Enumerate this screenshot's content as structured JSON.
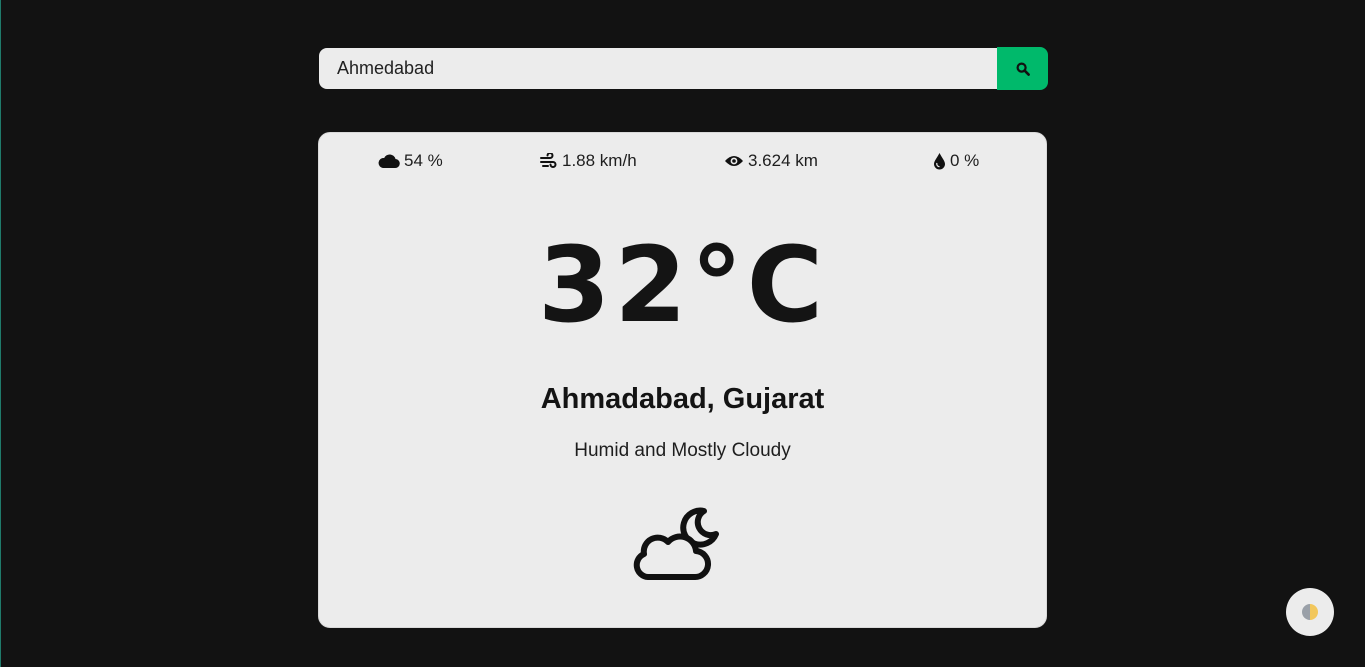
{
  "search": {
    "value": "Ahmedabad",
    "button_icon": "search-icon"
  },
  "stats": {
    "cloudiness": {
      "icon": "cloud-icon",
      "text": "54 %"
    },
    "wind": {
      "icon": "wind-icon",
      "text": "1.88 km/h"
    },
    "visibility": {
      "icon": "eye-icon",
      "text": "3.624 km"
    },
    "precipitation": {
      "icon": "droplet-icon",
      "text": "0 %"
    }
  },
  "weather": {
    "temperature": "32°C",
    "location": "Ahmadabad, Gujarat",
    "condition": "Humid and Mostly Cloudy",
    "icon": "cloud-moon-icon"
  },
  "theme_toggle": {
    "icon": "contrast-icon"
  },
  "colors": {
    "background": "#121212",
    "accent": "#00b96b",
    "card": "#ececec"
  }
}
